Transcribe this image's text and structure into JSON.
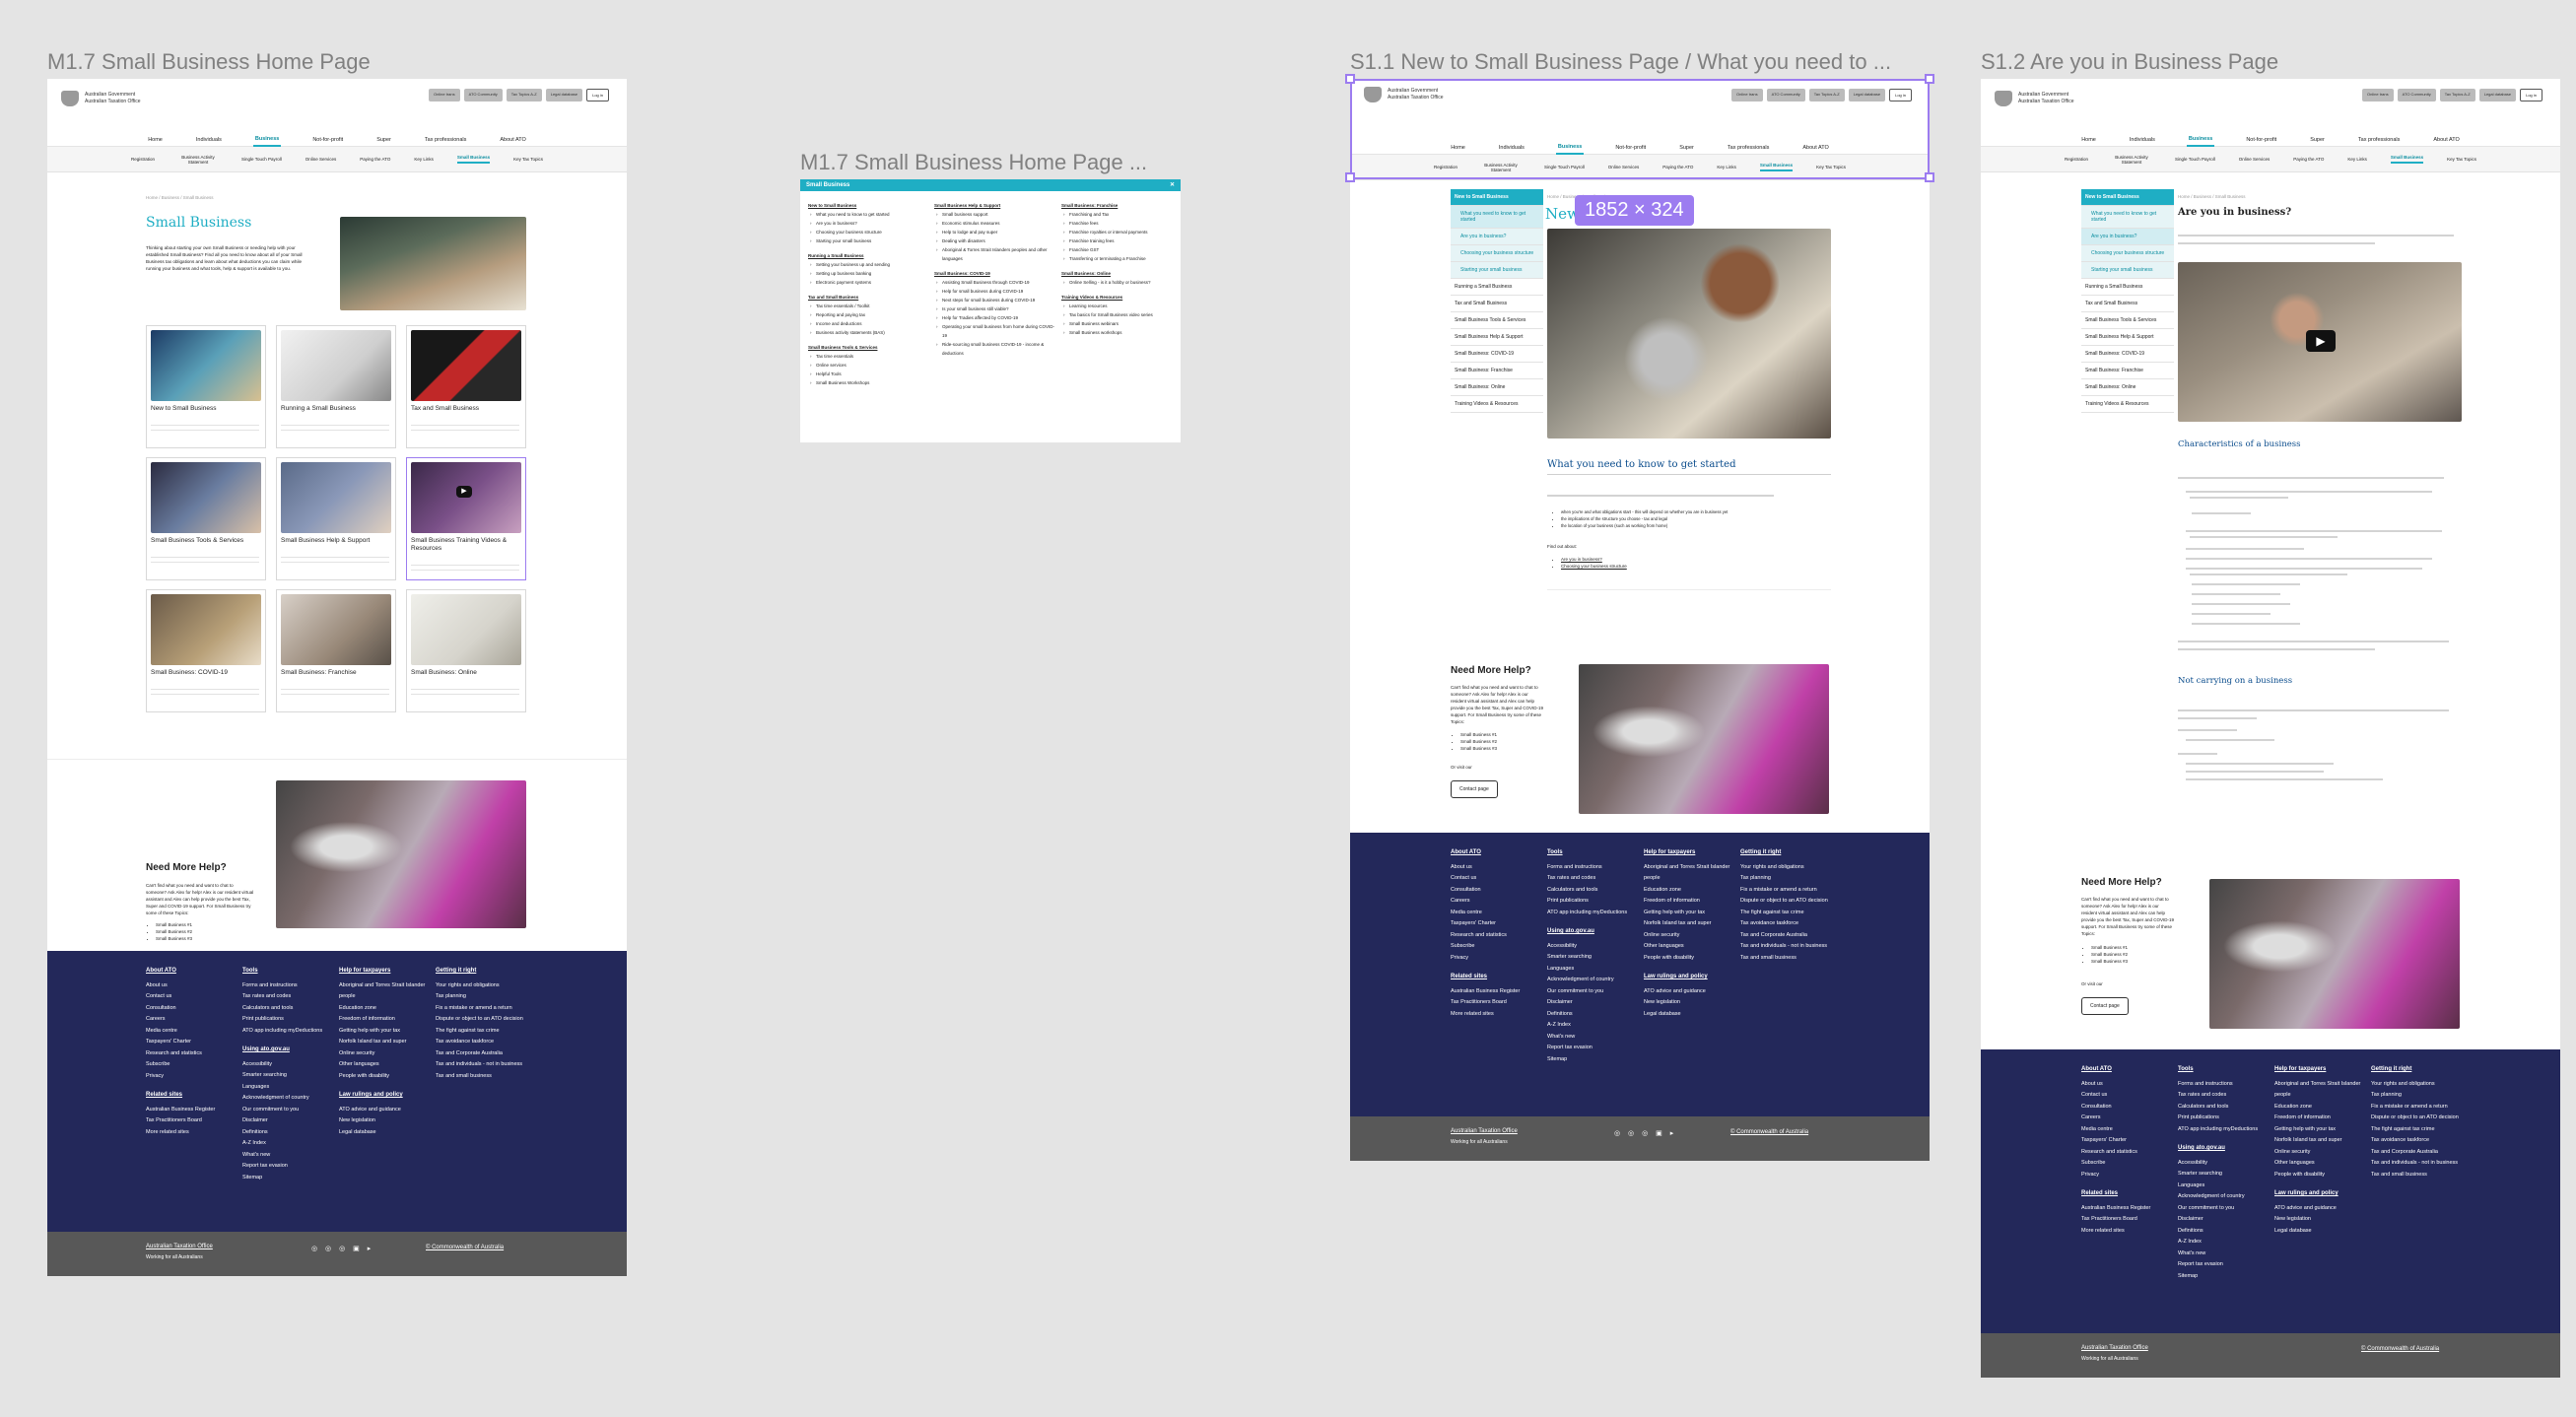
{
  "frames": {
    "m17": "M1.7 Small Business Home Page",
    "menu": "M1.7 Small Business Home Page ...",
    "s11": "S1.1 New to Small Business Page / What you need to ...",
    "s12": "S1.2 Are you in Business Page"
  },
  "header": {
    "logo_line1": "Australian Government",
    "logo_line2": "Australian Taxation Office",
    "util": [
      "Online trans",
      "ATO Community",
      "Tax Topics A-Z",
      "Legal database"
    ],
    "login": "Log in",
    "nav": [
      "Home",
      "Individuals",
      "Business",
      "Not-for-profit",
      "Super",
      "Tax professionals",
      "About ATO"
    ],
    "subnav": [
      "Registration",
      "Business Activity Statement",
      "Single Touch Payroll",
      "Online Services",
      "Paying the ATO",
      "Key Links",
      "Small Business",
      "Key Tax Topics"
    ]
  },
  "home": {
    "breadcrumb": "Home / Business / Small Business",
    "title": "Small Business",
    "intro": "Thinking about starting your own Small Business or needing help with your established Small Business? Find all you need to know about all of your Small Business tax obligations and learn about what deductions you can claim while running your business and what tools, help & support is available to you.",
    "tiles": [
      "New to Small Business",
      "Running a Small Business",
      "Tax and Small Business",
      "Small Business Tools & Services",
      "Small Business Help & Support",
      "Small Business Training Videos & Resources",
      "Small Business: COVID-19",
      "Small Business: Franchise",
      "Small Business: Online"
    ]
  },
  "help": {
    "title": "Need More Help?",
    "body": "Can't find what you need and want to chat to someone? Ask Alex for help! Alex is our resident virtual assistant and Alex can help provide you the best Tax, Super and COVID-19 support. For Small Business try some of these Topics:",
    "items": [
      "Small Business #1",
      "Small Business #2",
      "Small Business #3"
    ],
    "visit": "Or visit our",
    "button": "Contact page"
  },
  "footer": {
    "about": {
      "title": "About ATO",
      "items": [
        "About us",
        "Contact us",
        "Consultation",
        "Careers",
        "Media centre",
        "Taxpayers' Charter",
        "Research and statistics",
        "Subscribe",
        "Privacy"
      ]
    },
    "related": {
      "title": "Related sites",
      "items": [
        "Australian Business Register",
        "Tax Practitioners Board",
        "More related sites"
      ]
    },
    "tools": {
      "title": "Tools",
      "items": [
        "Forms and instructions",
        "Tax rates and codes",
        "Calculators and tools",
        "Print publications",
        "ATO app including myDeductions"
      ]
    },
    "using": {
      "title": "Using ato.gov.au",
      "items": [
        "Accessibility",
        "Smarter searching",
        "Languages",
        "Acknowledgment of country",
        "Our commitment to you",
        "Disclaimer",
        "Definitions",
        "A-Z Index",
        "What's new",
        "Report tax evasion",
        "Sitemap"
      ]
    },
    "help": {
      "title": "Help for taxpayers",
      "items": [
        "Aboriginal and Torres Strait Islander people",
        "Education zone",
        "Freedom of information",
        "Getting help with your tax",
        "Norfolk Island tax and super",
        "Online security",
        "Other languages",
        "People with disability"
      ]
    },
    "law": {
      "title": "Law rulings and policy",
      "items": [
        "ATO advice and guidance",
        "New legislation",
        "Legal database"
      ]
    },
    "right": {
      "title": "Getting it right",
      "items": [
        "Your rights and obligations",
        "Tax planning",
        "Fix a mistake or amend a return",
        "Dispute or object to an ATO decision",
        "The fight against tax crime",
        "Tax avoidance taskforce",
        "Tax and Corporate Australia",
        "Tax and individuals - not in business",
        "Tax and small business"
      ]
    },
    "org": "Australian Taxation Office",
    "tag": "Working for all Australians",
    "copy": "© Commonwealth of Australia",
    "social": "◎ ◎ ◎ ▣ ▸"
  },
  "menu": {
    "bar": "Small Business",
    "close": "✕",
    "cols": [
      [
        {
          "h": "New to Small Business",
          "i": [
            "What you need to know to get started",
            "Are you in business?",
            "Choosing your business structure",
            "Starting your small business"
          ]
        },
        {
          "h": "Running a Small Business",
          "i": [
            "Setting your business up and sending",
            "Setting up business banking",
            "Electronic payment systems"
          ]
        },
        {
          "h": "Tax and Small Business",
          "i": [
            "Tax time essentials / Toolkit",
            "Reporting and paying tax",
            "Income and deductions",
            "Business activity statements (BAS)"
          ]
        },
        {
          "h": "Small Business Tools & Services",
          "i": [
            "Tax time essentials",
            "Online services",
            "Helpful Tools",
            "Small Business Workshops"
          ]
        }
      ],
      [
        {
          "h": "Small Business Help & Support",
          "i": [
            "Small business support",
            "Economic stimulus measures",
            "Help to lodge and pay super",
            "Dealing with disasters",
            "Aboriginal & Torres Strait Islanders peoples and other languages"
          ]
        },
        {
          "h": "Small Business: COVID-19",
          "i": [
            "Assisting Small Business through COVID-19",
            "Help for small business during COVID-19",
            "Next steps for small business during COVID-19",
            "Is your small business still viable?",
            "Help for Tradies affected by COVID-19",
            "Operating your small business from home during COVID-19",
            "Ride-sourcing small business COVID-19 - income & deductions"
          ]
        }
      ],
      [
        {
          "h": "Small Business: Franchise",
          "i": [
            "Franchising and Tax",
            "Franchise fees",
            "Franchise royalties or interval payments",
            "Franchise training fees",
            "Franchise GST",
            "Transferring or terminating a Franchise"
          ]
        },
        {
          "h": "Small Business: Online",
          "i": [
            "Online Selling - is it a hobby or business?"
          ]
        },
        {
          "h": "Training Videos & Resources",
          "i": [
            "Learning resources",
            "Tax basics for Small Business video series",
            "Small Business webinars",
            "Small Business workshops"
          ]
        }
      ]
    ]
  },
  "side": {
    "head": "New to Small Business",
    "subs": [
      "What you need to know to get started",
      "Are you in business?",
      "Choosing your business structure",
      "Starting your small business"
    ],
    "items": [
      "Running a Small Business",
      "Tax and Small Business",
      "Small Business Tools & Services",
      "Small Business Help & Support",
      "Small Business: COVID-19",
      "Small Business: Franchise",
      "Small Business: Online",
      "Training Videos & Resources"
    ]
  },
  "s11": {
    "title_peek": "New",
    "h2": "What you need to know to get started",
    "find": "Find out about:",
    "links": [
      "Are you in business?",
      "Choosing your business structure"
    ],
    "bullets": [
      "when you're and what obligations start - this will depend on whether you are in business yet",
      "the implications of the structure you choose - tax and legal",
      "the location of your business (such as working from home)"
    ],
    "dimension": "1852 × 324"
  },
  "s12": {
    "title": "Are you in business?",
    "h_char": "Characteristics of a business",
    "h_not": "Not carrying on a business"
  }
}
